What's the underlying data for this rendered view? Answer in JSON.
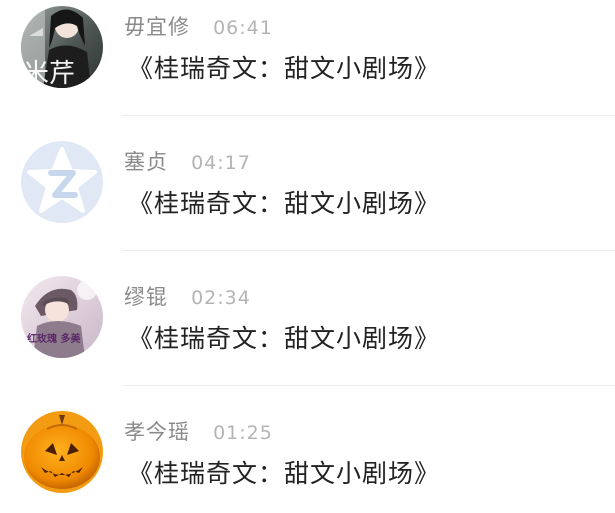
{
  "messages": [
    {
      "name": "毋宜修",
      "time": "06:41",
      "text": "《桂瑞奇文：甜文小剧场》",
      "avatar_icon": "photo-avatar-icon",
      "avatar_overlay": "米芹"
    },
    {
      "name": "塞贞",
      "time": "04:17",
      "text": "《桂瑞奇文：甜文小剧场》",
      "avatar_icon": "default-star-avatar-icon"
    },
    {
      "name": "缪锟",
      "time": "02:34",
      "text": "《桂瑞奇文：甜文小剧场》",
      "avatar_icon": "photo-avatar-icon",
      "avatar_overlay": "红玫瑰 多美"
    },
    {
      "name": "孝今瑶",
      "time": "01:25",
      "text": "《桂瑞奇文：甜文小剧场》",
      "avatar_icon": "pumpkin-avatar-icon"
    }
  ],
  "colors": {
    "name": "#8a8a8a",
    "time": "#b4b4b4",
    "message": "#222222",
    "divider": "#ececec",
    "default_avatar_bg": "#dfe8f4"
  }
}
